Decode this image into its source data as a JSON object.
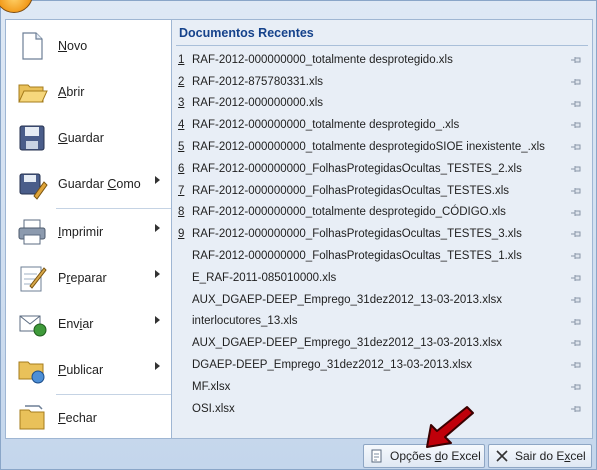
{
  "left_menu": [
    {
      "label": "Novo",
      "underline": "N",
      "rest": "ovo",
      "icon": "new-document-icon",
      "has_submenu": false
    },
    {
      "label": "Abrir",
      "underline": "A",
      "rest": "brir",
      "icon": "open-folder-icon",
      "has_submenu": false
    },
    {
      "label": "Guardar",
      "underline": "G",
      "rest": "uardar",
      "icon": "save-disk-icon",
      "has_submenu": false
    },
    {
      "label": "Guardar Como",
      "underline_pre": "Guardar ",
      "underline": "C",
      "rest": "omo",
      "icon": "save-as-icon",
      "has_submenu": true
    },
    {
      "label": "Imprimir",
      "underline": "I",
      "rest": "mprimir",
      "icon": "printer-icon",
      "has_submenu": true
    },
    {
      "label": "Preparar",
      "underline_pre": "P",
      "underline": "r",
      "rest": "eparar",
      "icon": "prepare-icon",
      "has_submenu": true
    },
    {
      "label": "Enviar",
      "underline_pre": "Env",
      "underline": "i",
      "rest": "ar",
      "icon": "send-icon",
      "has_submenu": true
    },
    {
      "label": "Publicar",
      "underline": "P",
      "rest": "ublicar",
      "icon": "publish-icon",
      "has_submenu": true
    },
    {
      "label": "Fechar",
      "underline": "F",
      "rest": "echar",
      "icon": "close-folder-icon",
      "has_submenu": false
    }
  ],
  "recent": {
    "title": "Documentos Recentes",
    "items": [
      {
        "num": "1",
        "name": "RAF-2012-000000000_totalmente desprotegido.xls"
      },
      {
        "num": "2",
        "name": "RAF-2012-875780331.xls"
      },
      {
        "num": "3",
        "name": "RAF-2012-000000000.xls"
      },
      {
        "num": "4",
        "name": "RAF-2012-000000000_totalmente desprotegido_.xls"
      },
      {
        "num": "5",
        "name": "RAF-2012-000000000_totalmente desprotegidoSIOE inexistente_.xls"
      },
      {
        "num": "6",
        "name": "RAF-2012-000000000_FolhasProtegidasOcultas_TESTES_2.xls"
      },
      {
        "num": "7",
        "name": "RAF-2012-000000000_FolhasProtegidasOcultas_TESTES.xls"
      },
      {
        "num": "8",
        "name": "RAF-2012-000000000_totalmente desprotegido_CÓDIGO.xls"
      },
      {
        "num": "9",
        "name": "RAF-2012-000000000_FolhasProtegidasOcultas_TESTES_3.xls"
      },
      {
        "num": "",
        "name": "RAF-2012-000000000_FolhasProtegidasOcultas_TESTES_1.xls"
      },
      {
        "num": "",
        "name": "E_RAF-2011-085010000.xls"
      },
      {
        "num": "",
        "name": "AUX_DGAEP-DEEP_Emprego_31dez2012_13-03-2013.xlsx"
      },
      {
        "num": "",
        "name": "interlocutores_13.xls"
      },
      {
        "num": "",
        "name": "AUX_DGAEP-DEEP_Emprego_31dez2012_13-03-2013.xlsx"
      },
      {
        "num": "",
        "name": "DGAEP-DEEP_Emprego_31dez2012_13-03-2013.xlsx"
      },
      {
        "num": "",
        "name": "MF.xlsx"
      },
      {
        "num": "",
        "name": "OSI.xlsx"
      }
    ]
  },
  "buttons": {
    "options_pre": "Opções ",
    "options_u": "d",
    "options_rest": "o Excel",
    "exit_pre": "Sair do E",
    "exit_u": "x",
    "exit_rest": "cel"
  },
  "colors": {
    "title_blue": "#15428b",
    "annotation_red": "#c0000a"
  }
}
